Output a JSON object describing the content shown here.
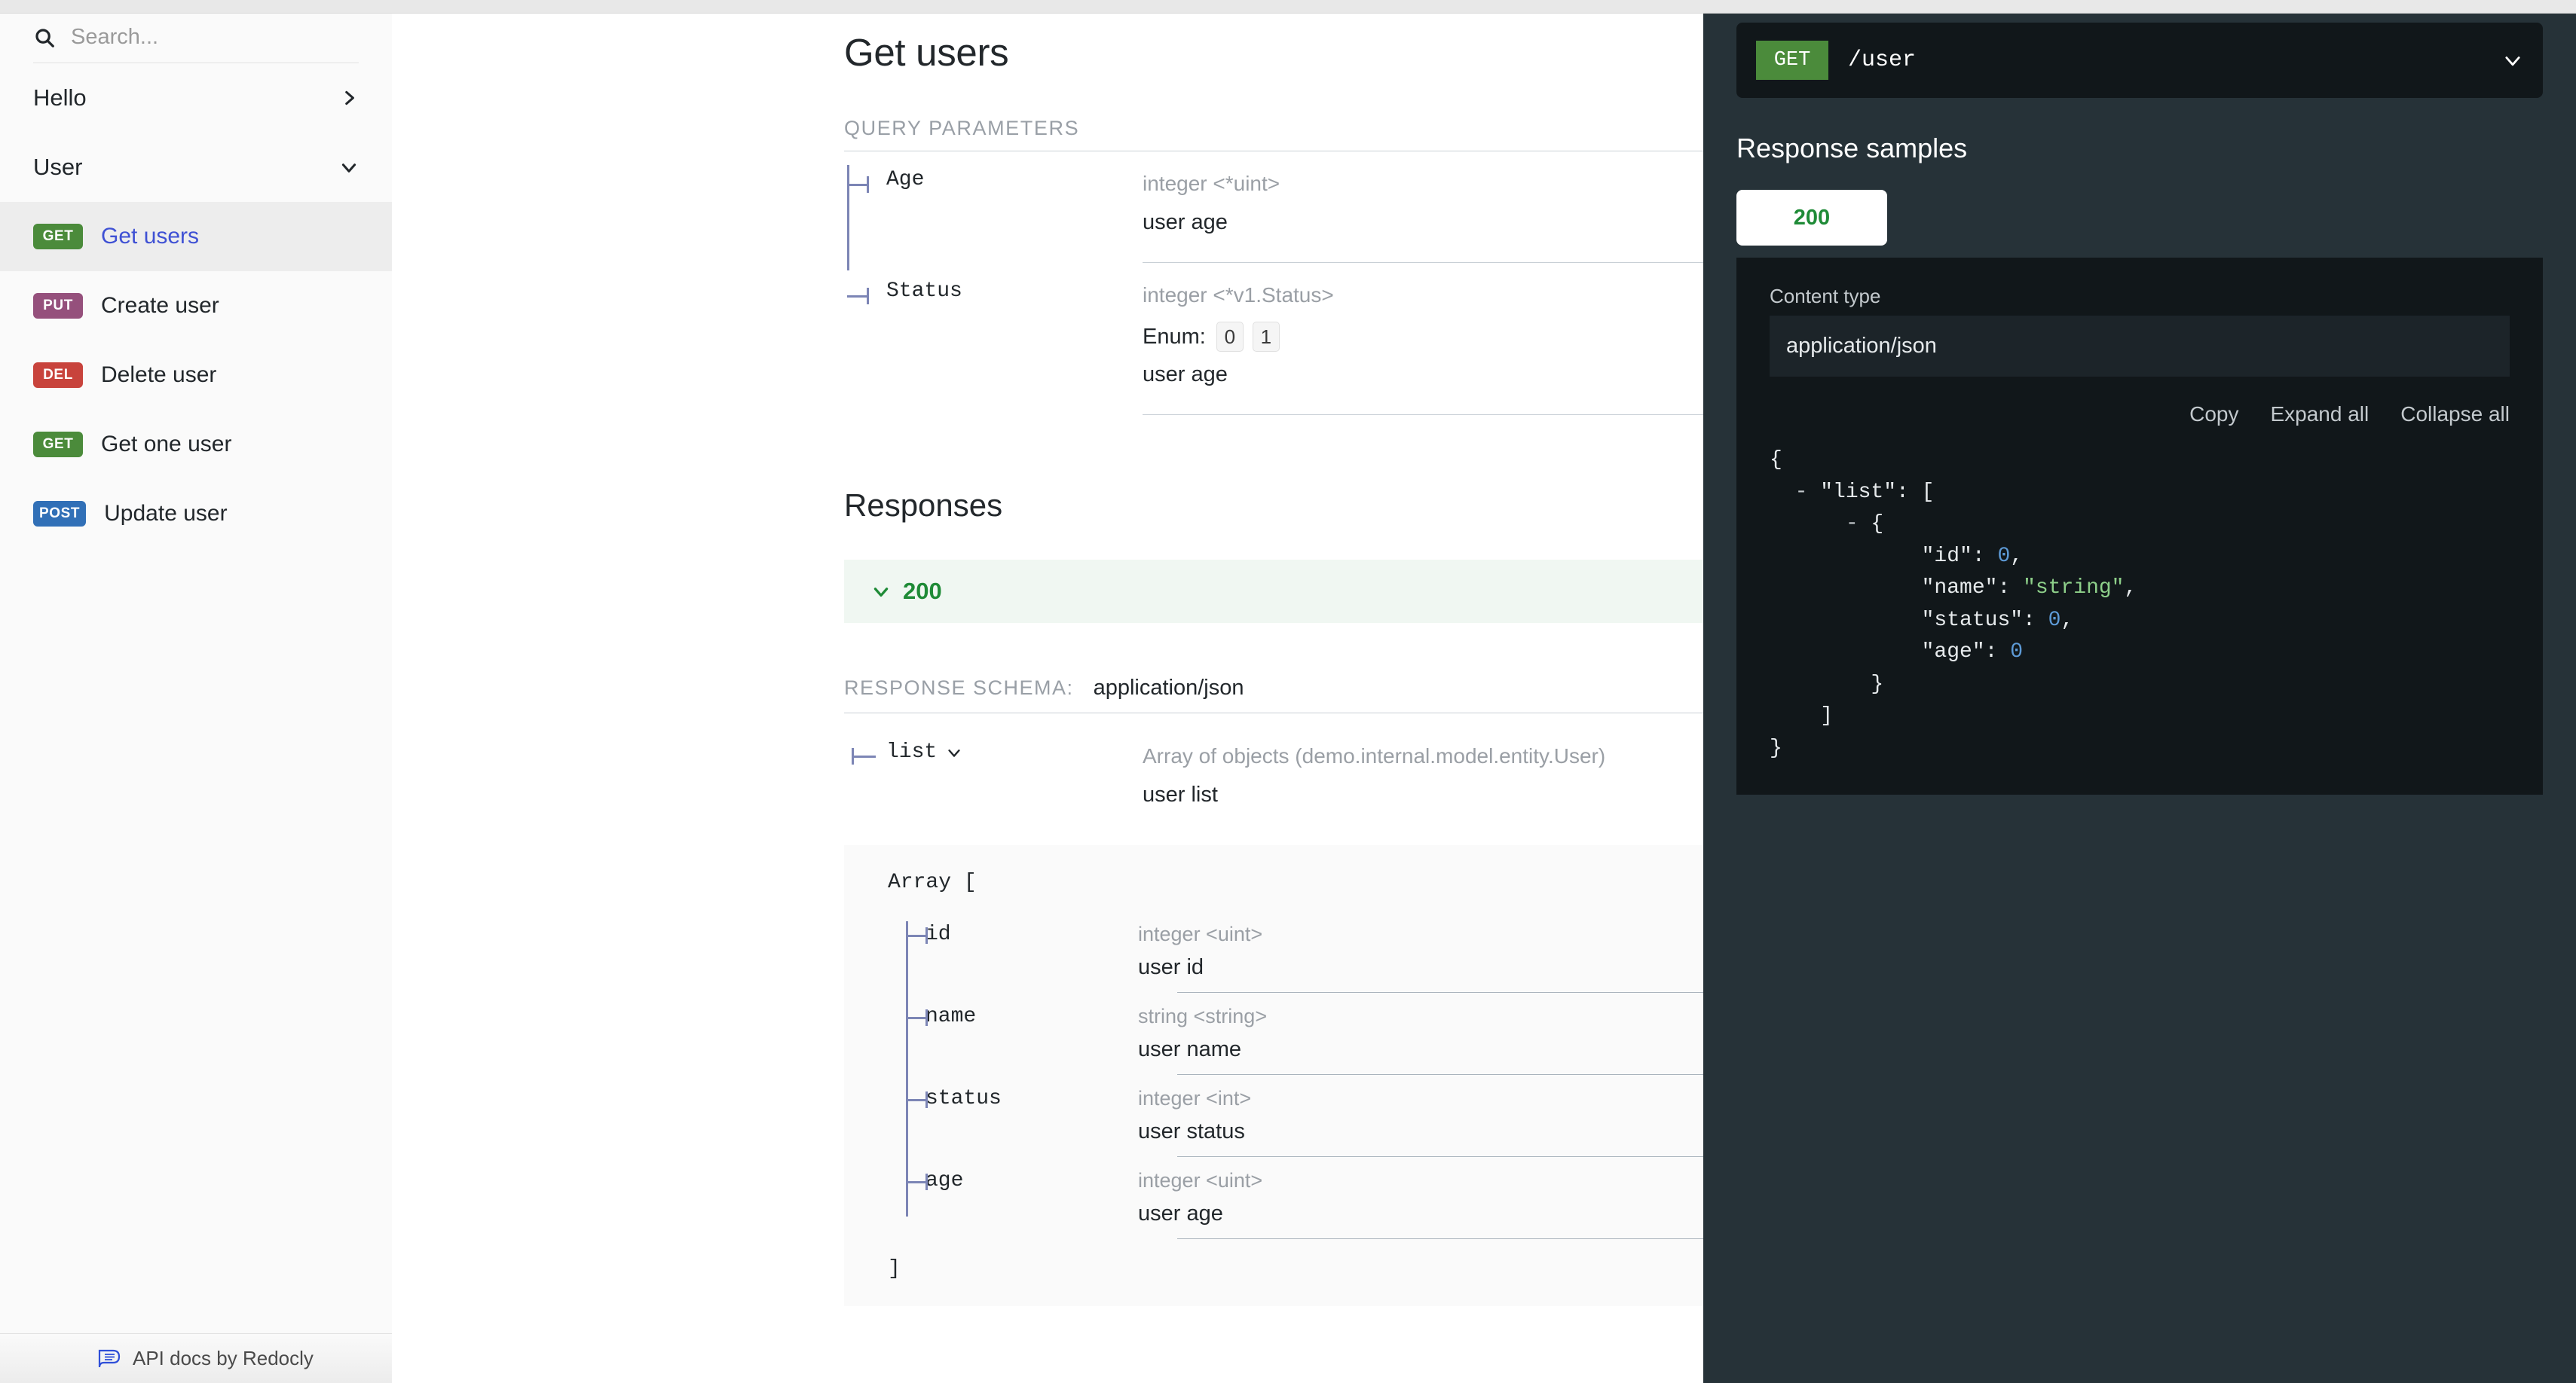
{
  "sidebar": {
    "search": {
      "placeholder": "Search...",
      "value": "",
      "icon": "search-icon"
    },
    "groups": [
      {
        "label": "Hello",
        "chevron": "chevron-right-icon",
        "expanded": false
      },
      {
        "label": "User",
        "chevron": "chevron-down-icon",
        "expanded": true
      }
    ],
    "operations": [
      {
        "verb": "GET",
        "label": "Get users",
        "color": "#4b8b3b",
        "active": true
      },
      {
        "verb": "PUT",
        "label": "Create user",
        "color": "#95507c",
        "active": false
      },
      {
        "verb": "DEL",
        "label": "Delete user",
        "color": "#c8433c",
        "active": false
      },
      {
        "verb": "GET",
        "label": "Get one user",
        "color": "#4b8b3b",
        "active": false
      },
      {
        "verb": "POST",
        "label": "Update user",
        "color": "#3170b7",
        "active": false
      }
    ],
    "footer": {
      "text": "API docs by Redocly",
      "icon": "redocly-logo-icon"
    }
  },
  "main": {
    "title": "Get users",
    "query_parameters_caption": "QUERY PARAMETERS",
    "query_parameters": [
      {
        "name": "Age",
        "type": "integer <*uint>",
        "description": "user age",
        "enum": null
      },
      {
        "name": "Status",
        "type": "integer <*v1.Status>",
        "enum_label": "Enum:",
        "enum": [
          "0",
          "1"
        ],
        "description": "user age"
      }
    ],
    "responses_title": "Responses",
    "response": {
      "code": "200",
      "chevron": "chevron-down-icon",
      "schema_label": "RESPONSE SCHEMA:",
      "schema_value": "application/json",
      "root_field": {
        "name": "list",
        "chevron": "chevron-down-icon",
        "type": "Array of objects (demo.internal.model.entity.User)",
        "description": "user list"
      },
      "array_open": "Array [",
      "array_close": "]",
      "fields": [
        {
          "name": "id",
          "type": "integer <uint>",
          "description": "user id"
        },
        {
          "name": "name",
          "type": "string <string>",
          "description": "user name"
        },
        {
          "name": "status",
          "type": "integer <int>",
          "description": "user status"
        },
        {
          "name": "age",
          "type": "integer <uint>",
          "description": "user age"
        }
      ]
    }
  },
  "right": {
    "endpoint": {
      "verb": "GET",
      "path": "/user",
      "chevron": "chevron-down-icon",
      "verb_color": "#4b8b3b"
    },
    "title": "Response samples",
    "tabs": [
      {
        "label": "200",
        "active": true
      }
    ],
    "content_type_label": "Content type",
    "content_type_value": "application/json",
    "actions": [
      "Copy",
      "Expand all",
      "Collapse all"
    ],
    "sample": {
      "lines": [
        [
          {
            "t": "{",
            "c": "plain"
          }
        ],
        [
          {
            "t": "  - ",
            "c": "fold"
          },
          {
            "t": "\"list\": [",
            "c": "plain"
          }
        ],
        [
          {
            "t": "      - ",
            "c": "fold"
          },
          {
            "t": "{",
            "c": "plain"
          }
        ],
        [
          {
            "t": "            \"id\": ",
            "c": "plain"
          },
          {
            "t": "0",
            "c": "num"
          },
          {
            "t": ",",
            "c": "plain"
          }
        ],
        [
          {
            "t": "            \"name\": ",
            "c": "plain"
          },
          {
            "t": "\"string\"",
            "c": "str"
          },
          {
            "t": ",",
            "c": "plain"
          }
        ],
        [
          {
            "t": "            \"status\": ",
            "c": "plain"
          },
          {
            "t": "0",
            "c": "num"
          },
          {
            "t": ",",
            "c": "plain"
          }
        ],
        [
          {
            "t": "            \"age\": ",
            "c": "plain"
          },
          {
            "t": "0",
            "c": "num"
          }
        ],
        [
          {
            "t": "        }",
            "c": "plain"
          }
        ],
        [
          {
            "t": "    ]",
            "c": "plain"
          }
        ],
        [
          {
            "t": "}",
            "c": "plain"
          }
        ]
      ]
    }
  },
  "colors": {
    "get": "#4b8b3b",
    "put": "#95507c",
    "del": "#c8433c",
    "post": "#3170b7",
    "success": "#1f8b37",
    "link": "#3f51d4",
    "panel_bg": "#263238",
    "code_bg": "#11171a",
    "tree_line": "#7c85b5"
  }
}
